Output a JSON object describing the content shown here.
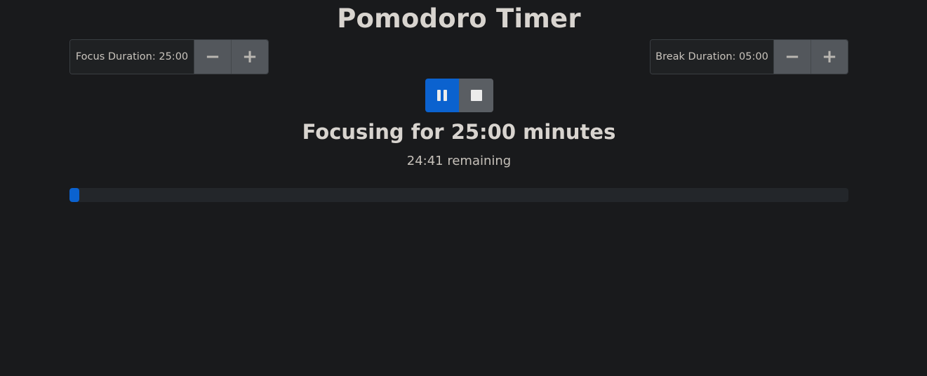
{
  "page": {
    "title": "Pomodoro Timer"
  },
  "focus": {
    "label": "Focus Duration: 25:00",
    "decrement_icon": "minus-icon",
    "increment_icon": "plus-icon"
  },
  "break": {
    "label": "Break Duration: 05:00",
    "decrement_icon": "minus-icon",
    "increment_icon": "plus-icon"
  },
  "controls": {
    "pause_icon": "pause-icon",
    "stop_icon": "stop-icon"
  },
  "status": {
    "heading": "Focusing for 25:00 minutes",
    "remaining": "24:41 remaining"
  },
  "progress": {
    "fraction": 0.0127
  },
  "colors": {
    "accent": "#0b62cf",
    "background": "#191a1c",
    "secondary_button": "#5a5e63"
  }
}
